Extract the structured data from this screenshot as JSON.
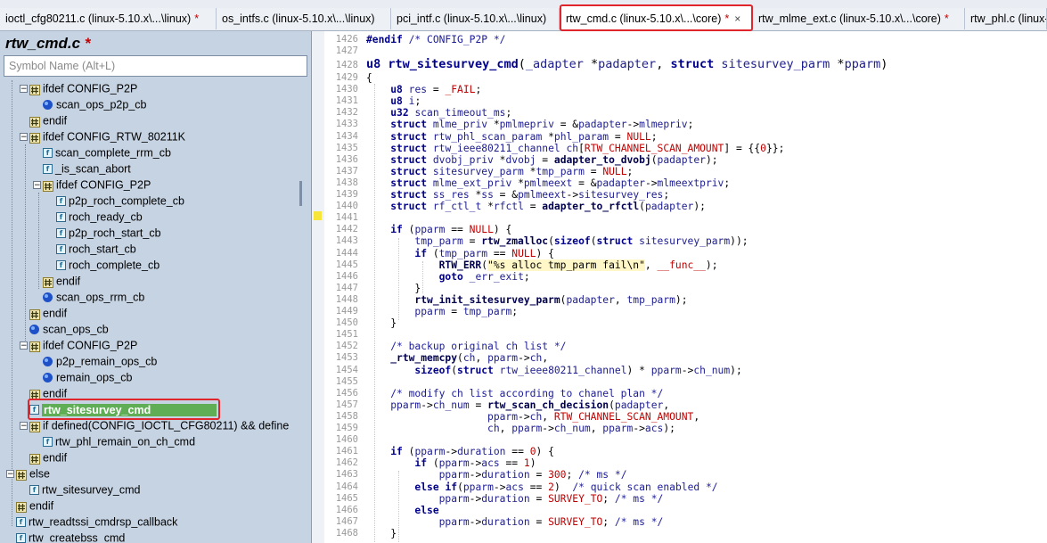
{
  "tabs": [
    {
      "label": "ioctl_cfg80211.c (linux-5.10.x\\...\\linux)",
      "modified": "*",
      "active": false
    },
    {
      "label": "os_intfs.c (linux-5.10.x\\...\\linux)",
      "modified": "",
      "active": false
    },
    {
      "label": "pci_intf.c (linux-5.10.x\\...\\linux)",
      "modified": "",
      "active": false
    },
    {
      "label": "rtw_cmd.c (linux-5.10.x\\...\\core)",
      "modified": "*",
      "active": true,
      "close": "×"
    },
    {
      "label": "rtw_mlme_ext.c (linux-5.10.x\\...\\core)",
      "modified": "*",
      "active": false
    },
    {
      "label": "rtw_phl.c (linux-5.10.x",
      "modified": "",
      "active": false
    }
  ],
  "symbol_panel": {
    "file_title": "rtw_cmd.c",
    "file_modified": "*",
    "search_placeholder": "Symbol Name (Alt+L)",
    "tree": [
      {
        "label": "ifdef CONFIG_P2P",
        "icon": "hash-icon",
        "depth": 1,
        "expander": "minus"
      },
      {
        "label": "scan_ops_p2p_cb",
        "icon": "prototype-icon",
        "depth": 2
      },
      {
        "label": "endif",
        "icon": "hash-icon",
        "depth": 1
      },
      {
        "label": "ifdef CONFIG_RTW_80211K",
        "icon": "hash-icon",
        "depth": 1,
        "expander": "minus"
      },
      {
        "label": "scan_complete_rrm_cb",
        "icon": "function-icon",
        "depth": 2
      },
      {
        "label": "_is_scan_abort",
        "icon": "function-icon",
        "depth": 2
      },
      {
        "label": "ifdef CONFIG_P2P",
        "icon": "hash-icon",
        "depth": 2,
        "expander": "minus"
      },
      {
        "label": "p2p_roch_complete_cb",
        "icon": "function-icon",
        "depth": 3
      },
      {
        "label": "roch_ready_cb",
        "icon": "function-icon",
        "depth": 3
      },
      {
        "label": "p2p_roch_start_cb",
        "icon": "function-icon",
        "depth": 3
      },
      {
        "label": "roch_start_cb",
        "icon": "function-icon",
        "depth": 3
      },
      {
        "label": "roch_complete_cb",
        "icon": "function-icon",
        "depth": 3
      },
      {
        "label": "endif",
        "icon": "hash-icon",
        "depth": 2
      },
      {
        "label": "scan_ops_rrm_cb",
        "icon": "prototype-icon",
        "depth": 2
      },
      {
        "label": "endif",
        "icon": "hash-icon",
        "depth": 1
      },
      {
        "label": "scan_ops_cb",
        "icon": "prototype-icon",
        "depth": 1
      },
      {
        "label": "ifdef CONFIG_P2P",
        "icon": "hash-icon",
        "depth": 1,
        "expander": "minus"
      },
      {
        "label": "p2p_remain_ops_cb",
        "icon": "prototype-icon",
        "depth": 2
      },
      {
        "label": "remain_ops_cb",
        "icon": "prototype-icon",
        "depth": 2
      },
      {
        "label": "endif",
        "icon": "hash-icon",
        "depth": 1
      },
      {
        "label": "rtw_sitesurvey_cmd",
        "icon": "function-icon",
        "depth": 1,
        "selected": true
      },
      {
        "label": "if defined(CONFIG_IOCTL_CFG80211) && define",
        "icon": "hash-icon",
        "depth": 1,
        "expander": "minus"
      },
      {
        "label": "rtw_phl_remain_on_ch_cmd",
        "icon": "function-icon",
        "depth": 2
      },
      {
        "label": "endif",
        "icon": "hash-icon",
        "depth": 1
      },
      {
        "label": "else",
        "icon": "hash-icon",
        "depth": 0,
        "expander": "minus"
      },
      {
        "label": "rtw_sitesurvey_cmd",
        "icon": "function-icon",
        "depth": 1
      },
      {
        "label": "endif",
        "icon": "hash-icon",
        "depth": 0
      },
      {
        "label": "rtw_readtssi_cmdrsp_callback",
        "icon": "function-icon",
        "depth": 0
      },
      {
        "label": "rtw_createbss_cmd",
        "icon": "function-icon",
        "depth": 0
      }
    ]
  },
  "editor": {
    "line_numbers": [
      "1426",
      "1427",
      "1428",
      "1429",
      "1430",
      "1431",
      "1432",
      "1433",
      "1434",
      "1435",
      "1436",
      "1437",
      "1438",
      "1439",
      "1440",
      "1441",
      "1442",
      "1443",
      "1444",
      "1445",
      "1446",
      "1447",
      "1448",
      "1449",
      "1450",
      "1451",
      "1452",
      "1453",
      "1454",
      "1455",
      "1456",
      "1457",
      "1458",
      "1459",
      "1460",
      "1461",
      "1462",
      "1463",
      "1464",
      "1465",
      "1466",
      "1467",
      "1468"
    ],
    "lines": [
      "#endif /* CONFIG_P2P */",
      "",
      "u8 rtw_sitesurvey_cmd(_adapter *padapter, struct sitesurvey_parm *pparm)",
      "{",
      "    u8 res = _FAIL;",
      "    u8 i;",
      "    u32 scan_timeout_ms;",
      "    struct mlme_priv *pmlmepriv = &padapter->mlmepriv;",
      "    struct rtw_phl_scan_param *phl_param = NULL;",
      "    struct rtw_ieee80211_channel ch[RTW_CHANNEL_SCAN_AMOUNT] = {{0}};",
      "    struct dvobj_priv *dvobj = adapter_to_dvobj(padapter);",
      "    struct sitesurvey_parm *tmp_parm = NULL;",
      "    struct mlme_ext_priv *pmlmeext = &padapter->mlmeextpriv;",
      "    struct ss_res *ss = &pmlmeext->sitesurvey_res;",
      "    struct rf_ctl_t *rfctl = adapter_to_rfctl(padapter);",
      "",
      "    if (pparm == NULL) {",
      "        tmp_parm = rtw_zmalloc(sizeof(struct sitesurvey_parm));",
      "        if (tmp_parm == NULL) {",
      "            RTW_ERR(\"%s alloc tmp_parm fail\\n\", __func__);",
      "            goto _err_exit;",
      "        }",
      "        rtw_init_sitesurvey_parm(padapter, tmp_parm);",
      "        pparm = tmp_parm;",
      "    }",
      "",
      "    /* backup original ch list */",
      "    _rtw_memcpy(ch, pparm->ch,",
      "        sizeof(struct rtw_ieee80211_channel) * pparm->ch_num);",
      "",
      "    /* modify ch list according to chanel plan */",
      "    pparm->ch_num = rtw_scan_ch_decision(padapter,",
      "                    pparm->ch, RTW_CHANNEL_SCAN_AMOUNT,",
      "                    ch, pparm->ch_num, pparm->acs);",
      "",
      "    if (pparm->duration == 0) {",
      "        if (pparm->acs == 1)",
      "            pparm->duration = 300; /* ms */",
      "        else if(pparm->acs == 2)  /* quick scan enabled */",
      "            pparm->duration = SURVEY_TO; /* ms */",
      "        else",
      "            pparm->duration = SURVEY_TO; /* ms */",
      "    }"
    ]
  },
  "colors": {
    "tab_highlight": "#e0262c",
    "selected_symbol": "#5fae55",
    "panel_bg": "#c6d3e3",
    "modified_star": "#c00000"
  }
}
